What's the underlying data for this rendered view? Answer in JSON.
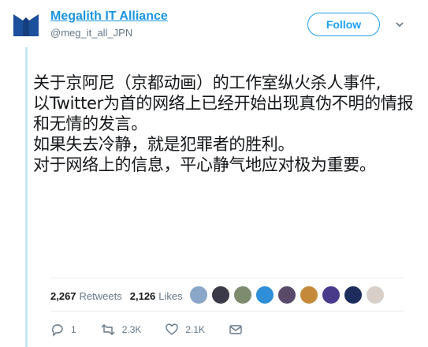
{
  "account": {
    "name": "Megalith IT Alliance",
    "handle": "@meg_it_all_JPN",
    "follow_label": "Follow"
  },
  "tweet": {
    "lines": [
      "关于京阿尼（京都动画）的工作室纵火杀人事件,",
      "以Twitter为首的网络上已经开始出现真伪不明的情报",
      "和无情的发言。",
      "如果失去冷静，就是犯罪者的胜利。",
      "对于网络上的信息，平心静气地应对极为重要。"
    ]
  },
  "stats": {
    "retweets_count": "2,267",
    "retweets_label": "Retweets",
    "likes_count": "2,126",
    "likes_label": "Likes"
  },
  "likers": [
    {
      "icon": "liker-avatar",
      "color": "#8aa6c8"
    },
    {
      "icon": "liker-avatar",
      "color": "#3a3a48"
    },
    {
      "icon": "liker-avatar",
      "color": "#7d8b6e"
    },
    {
      "icon": "liker-avatar",
      "color": "#2e8fd8"
    },
    {
      "icon": "liker-avatar",
      "color": "#5a4a6a"
    },
    {
      "icon": "liker-avatar",
      "color": "#c48a3a"
    },
    {
      "icon": "liker-avatar",
      "color": "#4a3a8a"
    },
    {
      "icon": "liker-avatar",
      "color": "#1c2c5c"
    },
    {
      "icon": "liker-avatar",
      "color": "#d8d0c8"
    }
  ],
  "actions": {
    "reply_count": "1",
    "retweet_count": "2.3K",
    "like_count": "2.1K"
  },
  "colors": {
    "brand": "#1da1f2",
    "name_link": "#1b95e0",
    "logo": "#1c4f9c"
  }
}
